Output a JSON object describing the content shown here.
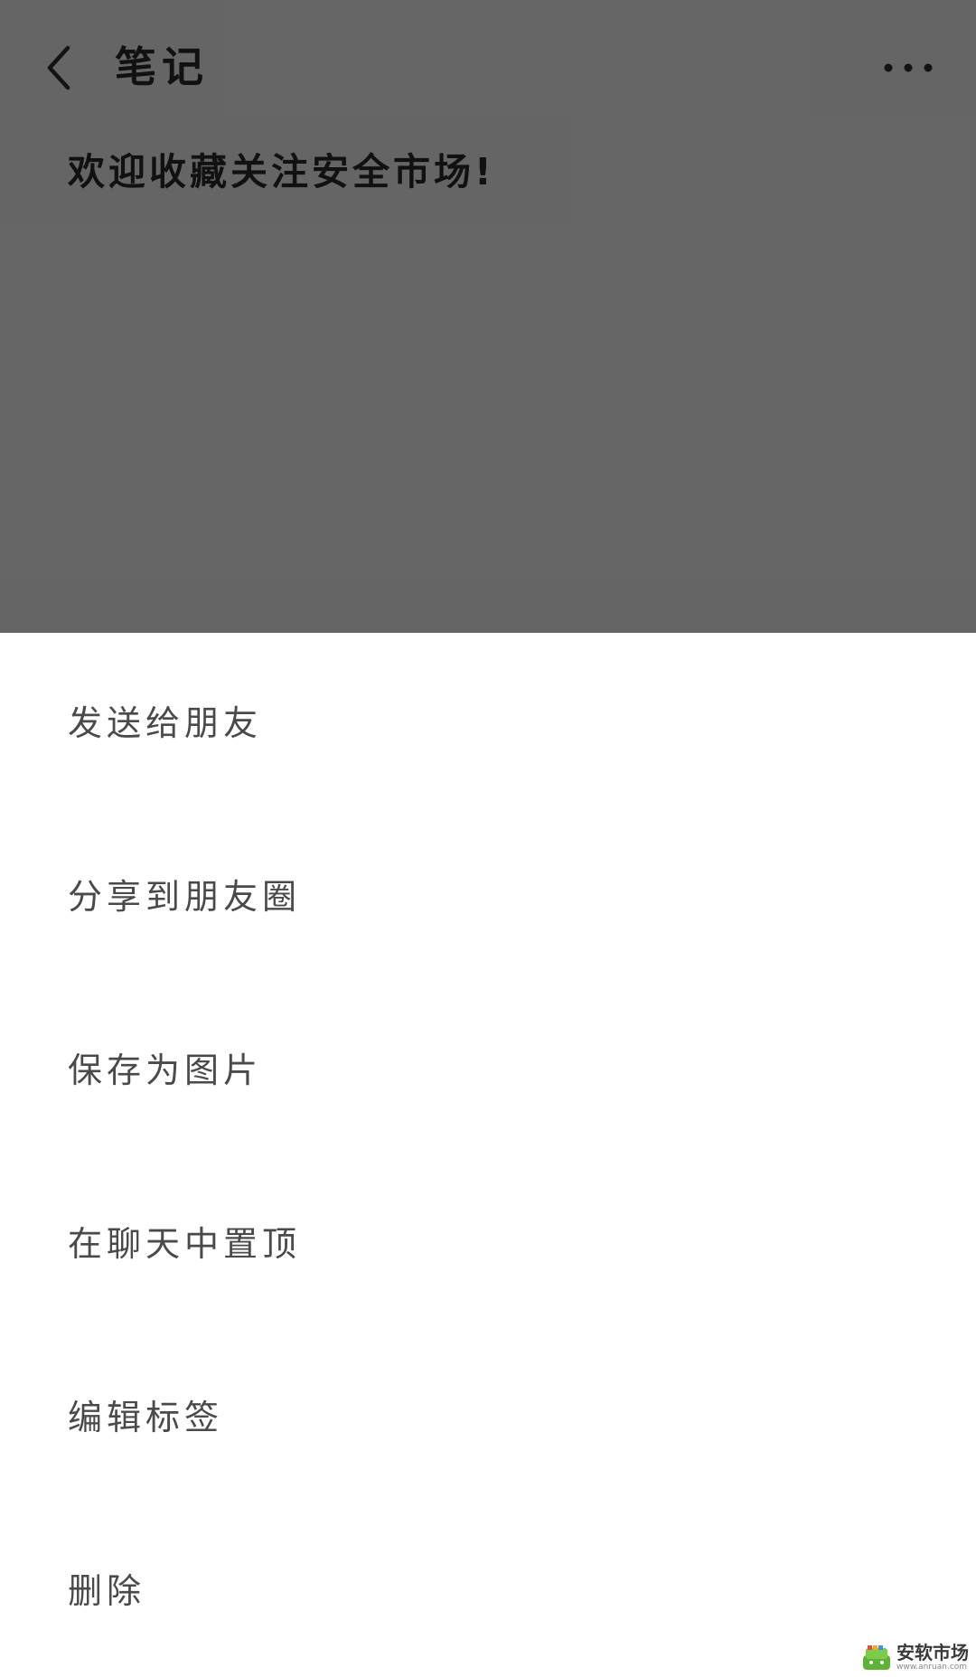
{
  "header": {
    "title": "笔记",
    "back_icon": "chevron-left-icon",
    "more_icon": "more-horizontal-icon"
  },
  "note": {
    "content": "欢迎收藏关注安全市场!"
  },
  "action_sheet": {
    "items": [
      {
        "label": "发送给朋友"
      },
      {
        "label": "分享到朋友圈"
      },
      {
        "label": "保存为图片"
      },
      {
        "label": "在聊天中置顶"
      },
      {
        "label": "编辑标签"
      },
      {
        "label": "删除"
      }
    ]
  },
  "watermark": {
    "title": "安软市场",
    "url": "www.anruan.com"
  },
  "colors": {
    "overlay_gray": "#6a6a6a",
    "sheet_bg": "#ffffff",
    "item_text": "#4a4a4a",
    "title_text": "#121212"
  }
}
